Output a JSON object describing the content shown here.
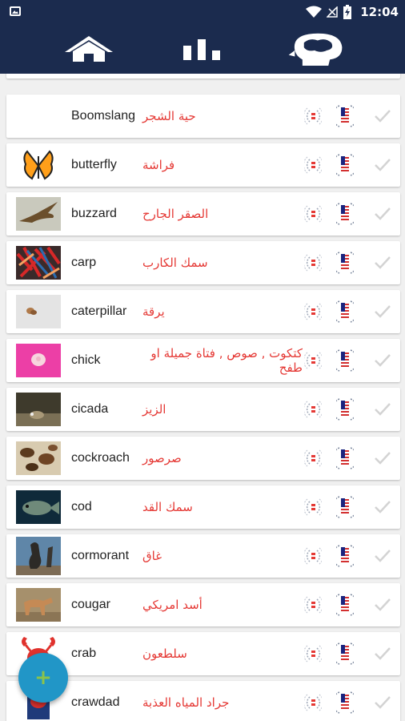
{
  "status_bar": {
    "time": "12:04",
    "icons": [
      "image-icon",
      "wifi-icon",
      "no-signal-icon",
      "battery-icon"
    ]
  },
  "nav": {
    "items": [
      "home-icon",
      "bar-chart-icon",
      "brain-head-icon"
    ]
  },
  "list": {
    "items": [
      {
        "en": "Boomslang",
        "ar": "حية الشجر"
      },
      {
        "en": "butterfly",
        "ar": "فراشة"
      },
      {
        "en": "buzzard",
        "ar": "الصقر الجارح"
      },
      {
        "en": "carp",
        "ar": "سمك الكارب"
      },
      {
        "en": "caterpillar",
        "ar": "يرقة"
      },
      {
        "en": "chick",
        "ar": "كتكوت , صوص , فتاة جميلة او طفح"
      },
      {
        "en": "cicada",
        "ar": "الزيز"
      },
      {
        "en": "cockroach",
        "ar": "صرصور"
      },
      {
        "en": "cod",
        "ar": "سمك القد"
      },
      {
        "en": "cormorant",
        "ar": "غاق"
      },
      {
        "en": "cougar",
        "ar": "أسد امريكي"
      },
      {
        "en": "crab",
        "ar": "سلطعون"
      },
      {
        "en": "crawdad",
        "ar": "جراد المياه العذبة"
      }
    ]
  },
  "fab": {
    "label": "+",
    "icon": "add-icon"
  },
  "colors": {
    "header": "#1b2b4e",
    "arabic_text": "#e53935",
    "fab": "#2196c7",
    "fab_plus": "#8bc34a"
  }
}
